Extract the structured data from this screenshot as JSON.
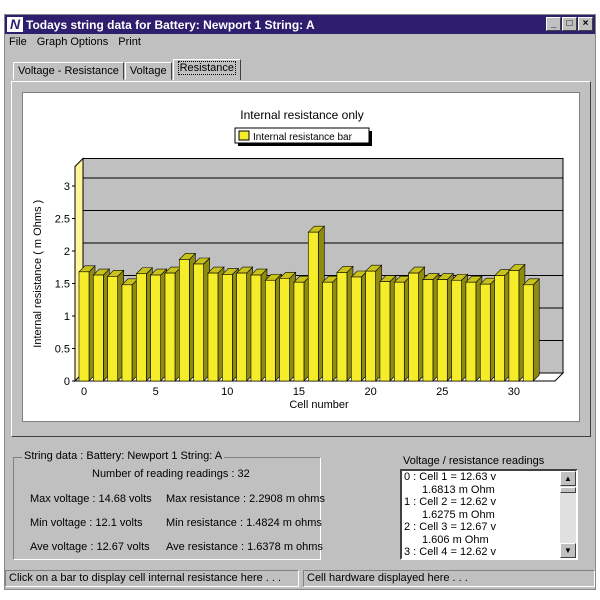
{
  "window": {
    "title": "Todays string data for Battery: Newport 1 String: A",
    "logo": "N",
    "controls": [
      "_",
      "□",
      "×"
    ]
  },
  "menu": [
    "File",
    "Graph Options",
    "Print"
  ],
  "tabs": [
    {
      "label": "Voltage - Resistance"
    },
    {
      "label": "Voltage"
    },
    {
      "label": "Resistance",
      "active": true
    }
  ],
  "chart_data": {
    "type": "bar",
    "title": "Internal resistance only",
    "legend": {
      "label": "Internal resistance bar",
      "placement": "top"
    },
    "xlabel": "Cell number",
    "ylabel": "Internal resistance ( m Ohms )",
    "ylim": [
      0,
      3.3
    ],
    "yticks": [
      "0",
      "0.5",
      "1",
      "1.5",
      "2",
      "2.5",
      "3"
    ],
    "xticks": [
      "0",
      "5",
      "10",
      "15",
      "20",
      "25",
      "30"
    ],
    "x": [
      0,
      1,
      2,
      3,
      4,
      5,
      6,
      7,
      8,
      9,
      10,
      11,
      12,
      13,
      14,
      15,
      16,
      17,
      18,
      19,
      20,
      21,
      22,
      23,
      24,
      25,
      26,
      27,
      28,
      29,
      30,
      31
    ],
    "values": [
      1.68,
      1.63,
      1.61,
      1.48,
      1.65,
      1.63,
      1.66,
      1.87,
      1.8,
      1.66,
      1.64,
      1.66,
      1.63,
      1.55,
      1.58,
      1.52,
      2.29,
      1.52,
      1.67,
      1.6,
      1.69,
      1.53,
      1.52,
      1.66,
      1.56,
      1.56,
      1.55,
      1.52,
      1.49,
      1.62,
      1.7,
      1.48
    ],
    "bar_color": "#f5ec2a",
    "wall_color": "#c0c0c0",
    "grid": true,
    "style": "3d"
  },
  "string_data": {
    "legend": "String data : Battery: Newport 1 String: A",
    "count": "Number of reading readings : 32",
    "max_voltage": "Max voltage : 14.68 volts",
    "min_voltage": "Min voltage : 12.1 volts",
    "ave_voltage": "Ave voltage : 12.67 volts",
    "max_resistance": "Max resistance : 2.2908 m ohms",
    "min_resistance": "Min resistance : 1.4824 m ohms",
    "ave_resistance": "Ave resistance : 1.6378 m ohms"
  },
  "readings": {
    "title": "Voltage / resistance readings",
    "items": [
      {
        "text": "0 : Cell 1 = 12.63 v"
      },
      {
        "text": "1.6813 m Ohm",
        "indent": true
      },
      {
        "text": "1 : Cell 2 = 12.62 v"
      },
      {
        "text": "1.6275 m Ohm",
        "indent": true
      },
      {
        "text": "2 : Cell 3 = 12.67 v"
      },
      {
        "text": "1.606 m Ohm",
        "indent": true
      },
      {
        "text": "3 : Cell 4 = 12.62 v"
      }
    ]
  },
  "status": {
    "left": "Click on a bar to display cell internal resistance here . . .",
    "right": "Cell hardware displayed here . . ."
  }
}
